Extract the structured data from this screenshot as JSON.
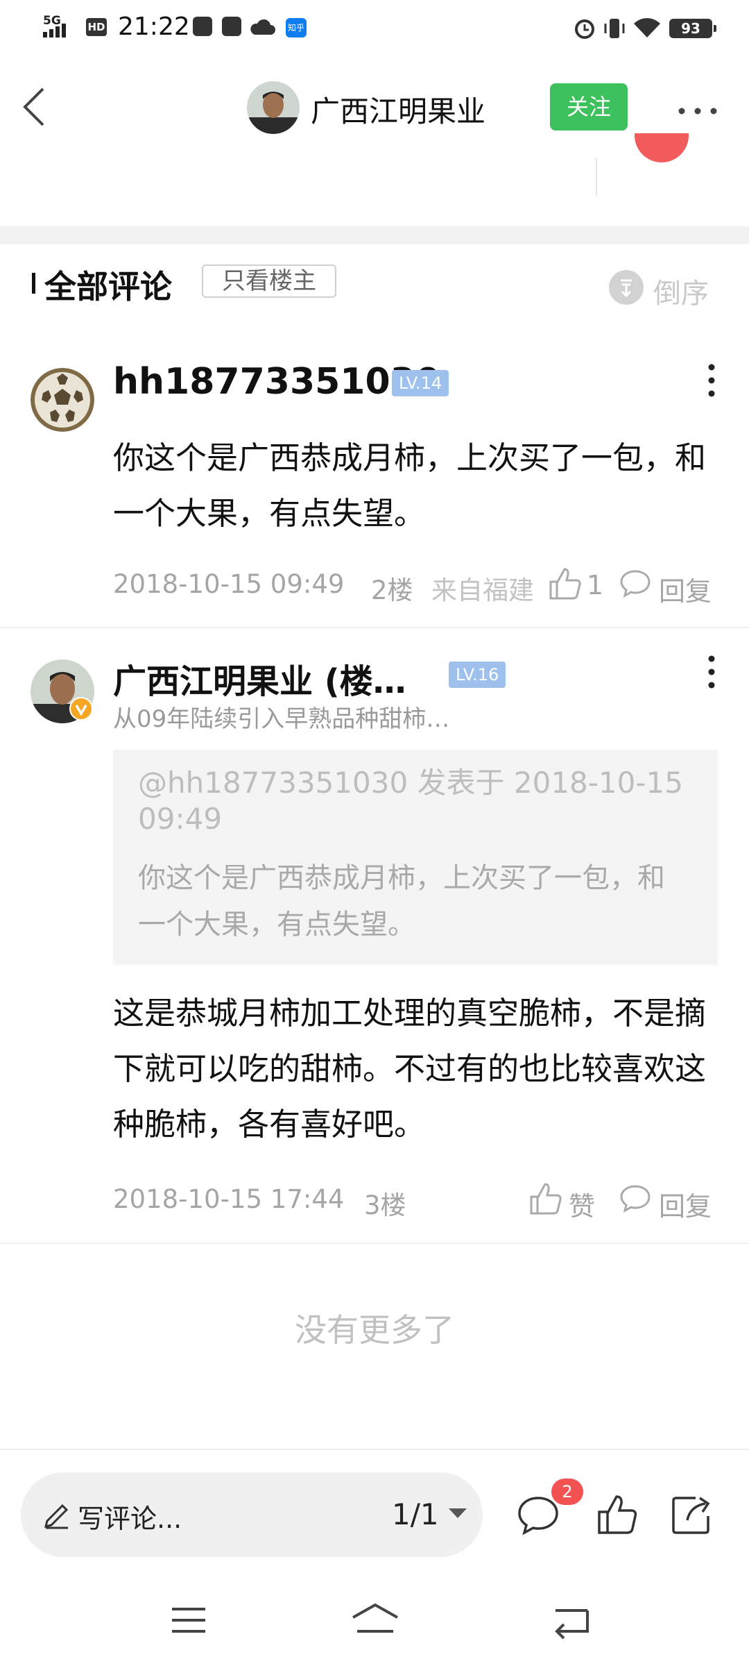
{
  "status_bar": {
    "network": "5G",
    "hd": "HD",
    "time": "21:22",
    "zhihu_icon": "知乎",
    "battery": "93"
  },
  "header": {
    "title": "广西江明果业",
    "follow_label": "关注"
  },
  "section": {
    "title": "全部评论",
    "filter_label": "只看楼主",
    "order_label": "倒序"
  },
  "comments": [
    {
      "username": "hh18773351030",
      "level": "LV.14",
      "text": "你这个是广西恭成月柿，上次买了一包，和一个大果，有点失望。",
      "datetime": "2018-10-15 09:49",
      "floor": "2楼",
      "location": "来自福建",
      "like_label": "1",
      "reply_label": "回复"
    },
    {
      "username": "广西江明果业 (楼…",
      "level": "LV.16",
      "signature": "从09年陆续引入早熟品种甜柿…",
      "quote_head": "@hh18773351030 发表于 2018-10-15 09:49",
      "quote_text": "你这个是广西恭成月柿，上次买了一包，和一个大果，有点失望。",
      "text": "这是恭城月柿加工处理的真空脆柿，不是摘下就可以吃的甜柿。不过有的也比较喜欢这种脆柿，各有喜好吧。",
      "datetime": "2018-10-15 17:44",
      "floor": "3楼",
      "like_label": "赞",
      "reply_label": "回复"
    }
  ],
  "footer": {
    "no_more": "没有更多了",
    "write_placeholder": "写评论...",
    "page_indicator": "1/1",
    "comment_count_badge": "2"
  },
  "icons": {
    "back": "back-icon",
    "more": "more-icon",
    "order": "sort-order-icon",
    "like": "thumb-up-icon",
    "reply": "chat-bubble-icon",
    "share": "share-icon",
    "pen": "pen-icon"
  },
  "colors": {
    "follow_green": "#3dc15c",
    "level_blue": "#9ec0ec",
    "badge_red": "#f25252"
  }
}
